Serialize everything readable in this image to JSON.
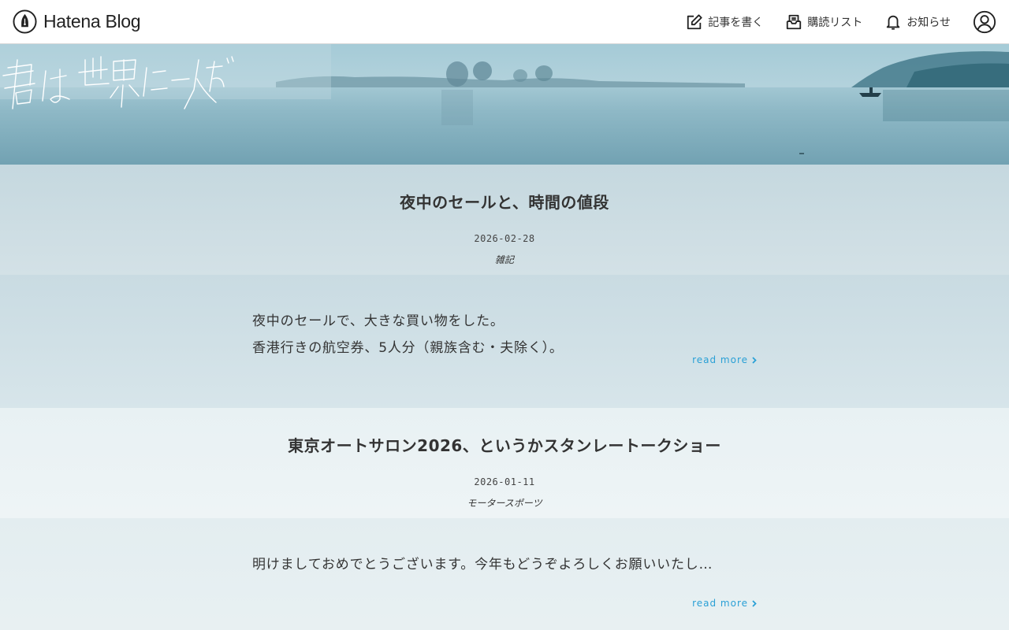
{
  "topbar": {
    "brand": "Hatena Blog",
    "nav": {
      "write": "記事を書く",
      "subscriptions": "購読リスト",
      "notifications": "お知らせ"
    }
  },
  "articles": [
    {
      "title": "夜中のセールと、時間の値段",
      "date": "2026-02-28",
      "category": "雑記",
      "excerpt_lines": [
        "夜中のセールで、大きな買い物をした。",
        "香港行きの航空券、5人分（親族含む・夫除く）。"
      ],
      "read_more": "read more"
    },
    {
      "title": "東京オートサロン2026、というかスタンレートークショー",
      "date": "2026-01-11",
      "category": "モータースポーツ",
      "excerpt_lines": [
        "明けましておめでとうございます。今年もどうぞよろしくお願いいたし…"
      ],
      "read_more": "read more"
    }
  ],
  "colors": {
    "accent_link": "#2aa0d6",
    "topbar_bg": "#ffffff"
  }
}
